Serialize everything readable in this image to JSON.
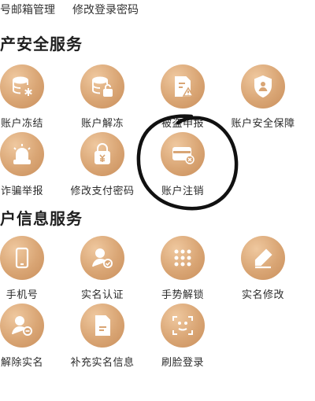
{
  "top_links": {
    "email_manage": "号邮箱管理",
    "change_login_pwd": "修改登录密码"
  },
  "sections": {
    "security": {
      "title": "产安全服务",
      "items": [
        {
          "label": "账户冻结",
          "icon": "database-snowflake-icon"
        },
        {
          "label": "账户解冻",
          "icon": "database-unlock-icon"
        },
        {
          "label": "被盗申报",
          "icon": "document-alert-icon"
        },
        {
          "label": "账户安全保障",
          "icon": "shield-user-icon"
        },
        {
          "label": "诈骗举报",
          "icon": "siren-icon"
        },
        {
          "label": "修改支付密码",
          "icon": "lock-yen-icon"
        },
        {
          "label": "账户注销",
          "icon": "card-cancel-icon"
        }
      ]
    },
    "info": {
      "title": "户信息服务",
      "items": [
        {
          "label": "手机号",
          "icon": "phone-icon"
        },
        {
          "label": "实名认证",
          "icon": "user-verified-icon"
        },
        {
          "label": "手势解锁",
          "icon": "gesture-dots-icon"
        },
        {
          "label": "实名修改",
          "icon": "pen-edit-icon"
        },
        {
          "label": "解除实名",
          "icon": "user-remove-icon"
        },
        {
          "label": "补充实名信息",
          "icon": "document-add-icon"
        },
        {
          "label": "刷脸登录",
          "icon": "face-scan-icon"
        }
      ]
    }
  },
  "colors": {
    "icon_gold": "#d9a574",
    "annotation": "#111111"
  }
}
